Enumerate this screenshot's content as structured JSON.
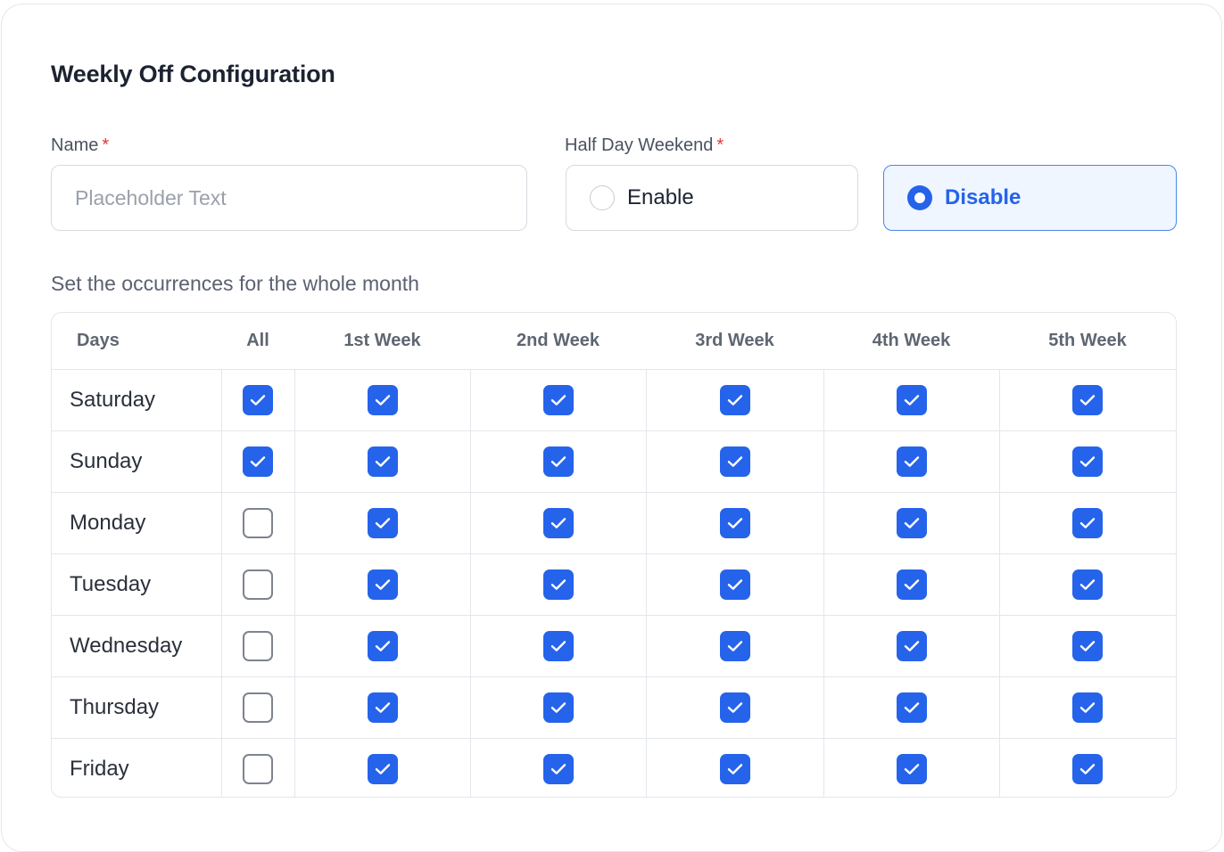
{
  "form": {
    "title": "Weekly Off Configuration",
    "name_label": "Name",
    "required_mark": "*",
    "name_value": "",
    "name_placeholder": "Placeholder Text",
    "half_day_label": "Half Day Weekend",
    "half_day_options": [
      {
        "label": "Enable",
        "selected": false
      },
      {
        "label": "Disable",
        "selected": true
      }
    ],
    "occurrence_subtitle": "Set the occurrences  for the whole month"
  },
  "table": {
    "headers": [
      "Days",
      "All",
      "1st Week",
      "2nd Week",
      "3rd Week",
      "4th Week",
      "5th Week"
    ],
    "rows": [
      {
        "day": "Saturday",
        "all": true,
        "weeks": [
          true,
          true,
          true,
          true,
          true
        ]
      },
      {
        "day": "Sunday",
        "all": true,
        "weeks": [
          true,
          true,
          true,
          true,
          true
        ]
      },
      {
        "day": "Monday",
        "all": false,
        "weeks": [
          true,
          true,
          true,
          true,
          true
        ]
      },
      {
        "day": "Tuesday",
        "all": false,
        "weeks": [
          true,
          true,
          true,
          true,
          true
        ]
      },
      {
        "day": "Wednesday",
        "all": false,
        "weeks": [
          true,
          true,
          true,
          true,
          true
        ]
      },
      {
        "day": "Thursday",
        "all": false,
        "weeks": [
          true,
          true,
          true,
          true,
          true
        ]
      },
      {
        "day": "Friday",
        "all": false,
        "weeks": [
          true,
          true,
          true,
          true,
          true
        ]
      }
    ]
  },
  "colors": {
    "accent": "#2563eb",
    "required": "#e5343a",
    "selected_bg": "#eff6ff",
    "border": "#e3e6eb"
  },
  "icons": {
    "checkbox_checked": "checkmark-icon",
    "radio": "radio-dot-icon"
  }
}
